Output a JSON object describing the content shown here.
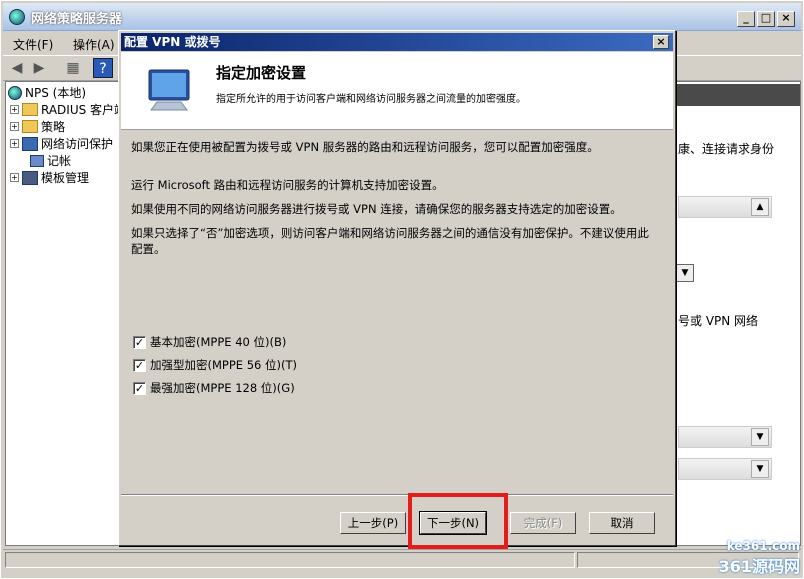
{
  "window": {
    "title": "网络策略服务器"
  },
  "menu": [
    "文件(F)",
    "操作(A)"
  ],
  "tree": [
    "NPS (本地)",
    "RADIUS 客户端",
    "策略",
    "网络访问保护",
    "记帐",
    "模板管理"
  ],
  "right": {
    "line1": "康、连接请求身份",
    "line2": "号或 VPN 网络"
  },
  "dialog": {
    "title": "配置 VPN 或拨号",
    "heading": "指定加密设置",
    "subheading": "指定所允许的用于访问客户端和网络访问服务器之间流量的加密强度。",
    "p1": "如果您正在使用被配置为拨号或 VPN 服务器的路由和远程访问服务，您可以配置加密强度。",
    "p2": "运行 Microsoft 路由和远程访问服务的计算机支持加密设置。",
    "p3": "如果使用不同的网络访问服务器进行拨号或 VPN 连接，请确保您的服务器支持选定的加密设置。",
    "p4": "如果只选择了“否”加密选项，则访问客户端和网络访问服务器之间的通信没有加密保护。不建议使用此配置。",
    "checkboxes": [
      "基本加密(MPPE 40 位)(B)",
      "加强型加密(MPPE 56 位)(T)",
      "最强加密(MPPE 128 位)(G)"
    ],
    "buttons": {
      "back": "上一步(P)",
      "next": "下一步(N)",
      "finish": "完成(F)",
      "cancel": "取消"
    }
  },
  "watermark": {
    "line1": "ke361.com",
    "line2": "361源码网"
  }
}
